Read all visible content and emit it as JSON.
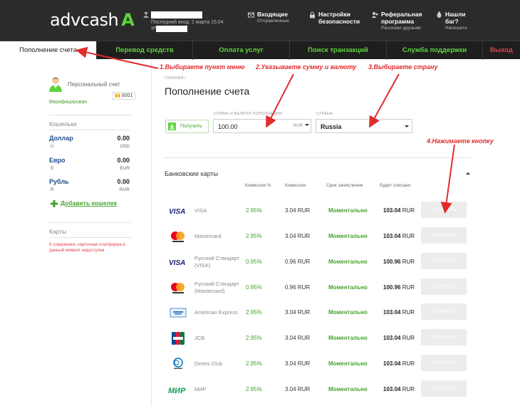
{
  "header": {
    "logo_text": "advcash",
    "last_login": "Последний вход: 2 марта 15:04",
    "ip_label": "IP",
    "items": [
      {
        "title": "Входящие",
        "subtitle": "Отправленные"
      },
      {
        "title": "Настройки",
        "subtitle": "безопасности"
      },
      {
        "title": "Реферальная",
        "subtitle": "программа",
        "note": "Расскажи друзьям"
      },
      {
        "title": "Нашли",
        "subtitle": "баг?",
        "note": "Напишите"
      }
    ]
  },
  "nav": {
    "items": [
      "Пополнение счета",
      "Перевод средств",
      "Оплата услуг",
      "Поиск транзакций",
      "Служба поддержки",
      "Выход"
    ]
  },
  "sidebar": {
    "account_name": "Персональный счет",
    "account_number": "0001",
    "verified": "Верифицирован",
    "wallets_title": "Кошельки",
    "wallets": [
      {
        "name": "Доллар",
        "balance": "0.00",
        "code": "U",
        "currency": "USD"
      },
      {
        "name": "Евро",
        "balance": "0.00",
        "code": "E",
        "currency": "EUR"
      },
      {
        "name": "Рубль",
        "balance": "0.00",
        "code": "R",
        "currency": "RUR"
      }
    ],
    "add_wallet": "Добавить кошелек",
    "cards_title": "Карты",
    "cards_warning": "К сожалению, карточная платформа в данный момент недоступна"
  },
  "main": {
    "breadcrumb": "ГЛАВНАЯ /",
    "title": "Пополнение счета",
    "get_button": "Получить",
    "amount_label": "СУММА И ВАЛЮТА ПОПОЛНЕНИЯ",
    "amount_value": "100.00",
    "currency": "RUR",
    "country_label": "СТРАНА",
    "country": "Russia",
    "section_title": "Банковские карты",
    "columns": [
      "Комиссия %",
      "Комиссия",
      "Срок зачисления",
      "Будет списано"
    ],
    "rows": [
      {
        "logo": "visa-logo",
        "name": "VISA",
        "name2": "",
        "pct": "2.95%",
        "fee": "3.04 RUR",
        "term": "Моментально",
        "debit": "103.04",
        "cur": "RUR",
        "button": "ПОЛУЧИТЬ"
      },
      {
        "logo": "mastercard-logo",
        "name": "Mastercard",
        "name2": "",
        "pct": "2.95%",
        "fee": "3.04 RUR",
        "term": "Моментально",
        "debit": "103.04",
        "cur": "RUR",
        "button": "ПОЛУЧИТЬ"
      },
      {
        "logo": "visa-logo",
        "name": "Русский Стандарт",
        "name2": "(VISA)",
        "pct": "0.95%",
        "fee": "0.96 RUR",
        "term": "Моментально",
        "debit": "100.96",
        "cur": "RUR",
        "button": "ПОЛУЧИТЬ"
      },
      {
        "logo": "mastercard-logo",
        "name": "Русский Стандарт",
        "name2": "(Mastercard)",
        "pct": "0.95%",
        "fee": "0.96 RUR",
        "term": "Моментально",
        "debit": "100.96",
        "cur": "RUR",
        "button": "ПОЛУЧИТЬ"
      },
      {
        "logo": "amex-logo",
        "name": "American Express",
        "name2": "",
        "pct": "2.95%",
        "fee": "3.04 RUR",
        "term": "Моментально",
        "debit": "103.04",
        "cur": "RUR",
        "button": "ПОЛУЧИТЬ"
      },
      {
        "logo": "jcb-logo",
        "name": "JCB",
        "name2": "",
        "pct": "2.95%",
        "fee": "3.04 RUR",
        "term": "Моментально",
        "debit": "103.04",
        "cur": "RUR",
        "button": "ПОЛУЧИТЬ"
      },
      {
        "logo": "diners-logo",
        "name": "Diners Club",
        "name2": "",
        "pct": "2.95%",
        "fee": "3.04 RUR",
        "term": "Моментально",
        "debit": "103.04",
        "cur": "RUR",
        "button": "ПОЛУЧИТЬ"
      },
      {
        "logo": "mir-logo",
        "name": "МИР",
        "name2": "",
        "pct": "2.95%",
        "fee": "3.04 RUR",
        "term": "Моментально",
        "debit": "103.04",
        "cur": "RUR",
        "button": "ПОЛУЧИТЬ"
      }
    ]
  },
  "annotations": [
    "1.Выбираете пункт меню",
    "2.Указываете сумму и валюту",
    "3.Выбираете страну",
    "4.Нажимаете кнопку"
  ],
  "colors": {
    "header_bg": "#2b2b2b",
    "accent_green": "#5ed43c",
    "annotation_red": "#e32b2b"
  }
}
